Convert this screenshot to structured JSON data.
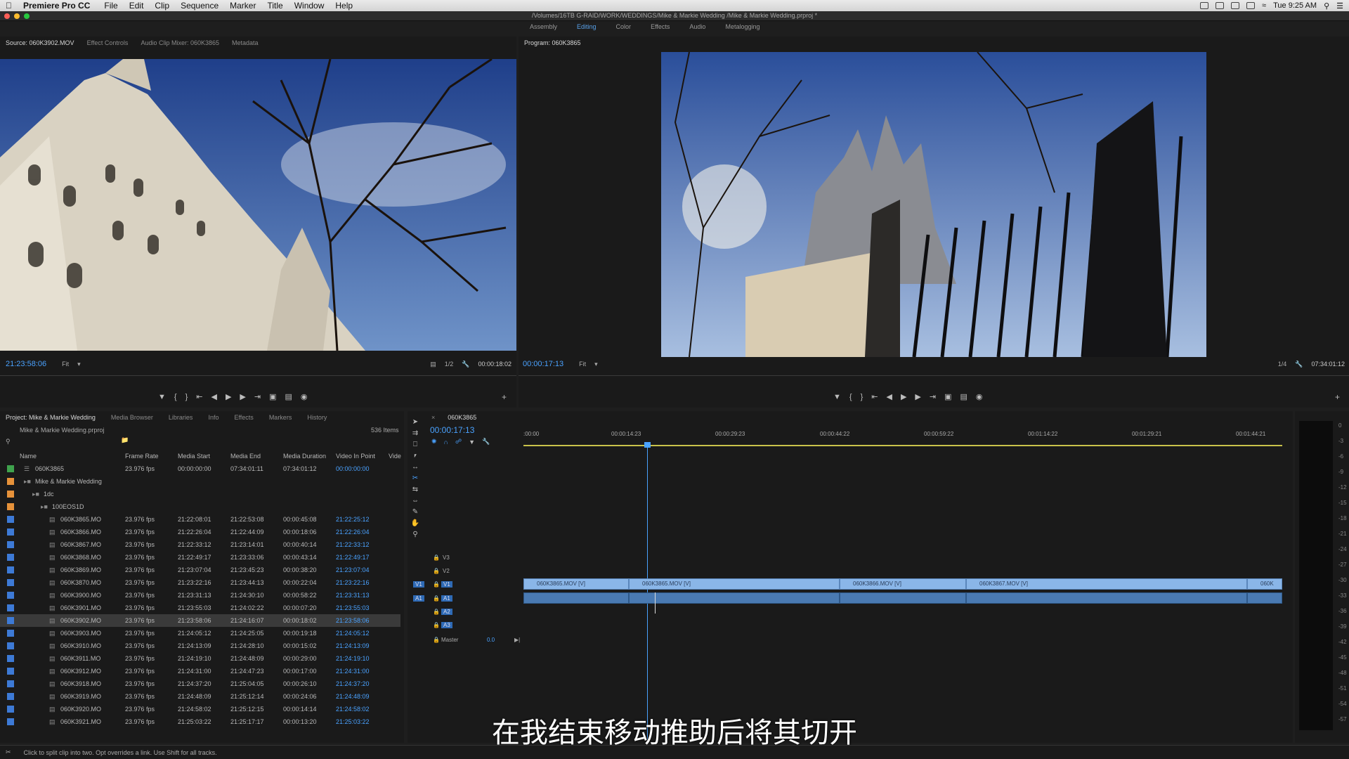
{
  "menubar": {
    "app": "Premiere Pro CC",
    "items": [
      "File",
      "Edit",
      "Clip",
      "Sequence",
      "Marker",
      "Title",
      "Window",
      "Help"
    ],
    "clock": "Tue 9:25 AM"
  },
  "title_path": "/Volumes/16TB G-RAID/WORK/WEDDINGS/Mike & Markie Wedding /Mike & Markie Wedding.prproj *",
  "workspaces": [
    "Assembly",
    "Editing",
    "Color",
    "Effects",
    "Audio",
    "Metalogging"
  ],
  "workspace_active": "Editing",
  "source": {
    "tabs": [
      "Source: 060K3902.MOV",
      "Effect Controls",
      "Audio Clip Mixer: 060K3865",
      "Metadata"
    ],
    "timecode": "21:23:58:06",
    "fit": "Fit",
    "resolution": "1/2",
    "duration": "00:00:18:02"
  },
  "program": {
    "tab": "Program: 060K3865",
    "timecode": "00:00:17:13",
    "fit": "Fit",
    "resolution": "1/4",
    "duration": "07:34:01:12"
  },
  "project": {
    "tabs": [
      "Project: Mike & Markie Wedding",
      "Media Browser",
      "Libraries",
      "Info",
      "Effects",
      "Markers",
      "History"
    ],
    "file": "Mike & Markie Wedding.prproj",
    "count": "536 Items",
    "columns": [
      "Name",
      "Frame Rate",
      "Media Start",
      "Media End",
      "Media Duration",
      "Video In Point",
      "Vide"
    ],
    "rows": [
      {
        "name": "060K3865",
        "fr": "23.976 fps",
        "ms": "00:00:00:00",
        "me": "07:34:01:11",
        "md": "07:34:01:12",
        "vi": "00:00:00:00",
        "color": "#3fa34d",
        "indent": 1
      },
      {
        "name": "Mike & Markie Wedding",
        "fr": "",
        "ms": "",
        "me": "",
        "md": "",
        "vi": "",
        "color": "#e6923a",
        "indent": 1
      },
      {
        "name": "1dc",
        "fr": "",
        "ms": "",
        "me": "",
        "md": "",
        "vi": "",
        "color": "#e6923a",
        "indent": 2
      },
      {
        "name": "100EOS1D",
        "fr": "",
        "ms": "",
        "me": "",
        "md": "",
        "vi": "",
        "color": "#e6923a",
        "indent": 3
      },
      {
        "name": "060K3865.MO",
        "fr": "23.976 fps",
        "ms": "21:22:08:01",
        "me": "21:22:53:08",
        "md": "00:00:45:08",
        "vi": "21:22:25:12",
        "color": "#3d7ad6",
        "indent": 4
      },
      {
        "name": "060K3866.MO",
        "fr": "23.976 fps",
        "ms": "21:22:26:04",
        "me": "21:22:44:09",
        "md": "00:00:18:06",
        "vi": "21:22:26:04",
        "color": "#3d7ad6",
        "indent": 4
      },
      {
        "name": "060K3867.MO",
        "fr": "23.976 fps",
        "ms": "21:22:33:12",
        "me": "21:23:14:01",
        "md": "00:00:40:14",
        "vi": "21:22:33:12",
        "color": "#3d7ad6",
        "indent": 4
      },
      {
        "name": "060K3868.MO",
        "fr": "23.976 fps",
        "ms": "21:22:49:17",
        "me": "21:23:33:06",
        "md": "00:00:43:14",
        "vi": "21:22:49:17",
        "color": "#3d7ad6",
        "indent": 4
      },
      {
        "name": "060K3869.MO",
        "fr": "23.976 fps",
        "ms": "21:23:07:04",
        "me": "21:23:45:23",
        "md": "00:00:38:20",
        "vi": "21:23:07:04",
        "color": "#3d7ad6",
        "indent": 4
      },
      {
        "name": "060K3870.MO",
        "fr": "23.976 fps",
        "ms": "21:23:22:16",
        "me": "21:23:44:13",
        "md": "00:00:22:04",
        "vi": "21:23:22:16",
        "color": "#3d7ad6",
        "indent": 4
      },
      {
        "name": "060K3900.MO",
        "fr": "23.976 fps",
        "ms": "21:23:31:13",
        "me": "21:24:30:10",
        "md": "00:00:58:22",
        "vi": "21:23:31:13",
        "color": "#3d7ad6",
        "indent": 4
      },
      {
        "name": "060K3901.MO",
        "fr": "23.976 fps",
        "ms": "21:23:55:03",
        "me": "21:24:02:22",
        "md": "00:00:07:20",
        "vi": "21:23:55:03",
        "color": "#3d7ad6",
        "indent": 4
      },
      {
        "name": "060K3902.MO",
        "fr": "23.976 fps",
        "ms": "21:23:58:06",
        "me": "21:24:16:07",
        "md": "00:00:18:02",
        "vi": "21:23:58:06",
        "color": "#3d7ad6",
        "indent": 4,
        "selected": true
      },
      {
        "name": "060K3903.MO",
        "fr": "23.976 fps",
        "ms": "21:24:05:12",
        "me": "21:24:25:05",
        "md": "00:00:19:18",
        "vi": "21:24:05:12",
        "color": "#3d7ad6",
        "indent": 4
      },
      {
        "name": "060K3910.MO",
        "fr": "23.976 fps",
        "ms": "21:24:13:09",
        "me": "21:24:28:10",
        "md": "00:00:15:02",
        "vi": "21:24:13:09",
        "color": "#3d7ad6",
        "indent": 4
      },
      {
        "name": "060K3911.MO",
        "fr": "23.976 fps",
        "ms": "21:24:19:10",
        "me": "21:24:48:09",
        "md": "00:00:29:00",
        "vi": "21:24:19:10",
        "color": "#3d7ad6",
        "indent": 4
      },
      {
        "name": "060K3912.MO",
        "fr": "23.976 fps",
        "ms": "21:24:31:00",
        "me": "21:24:47:23",
        "md": "00:00:17:00",
        "vi": "21:24:31:00",
        "color": "#3d7ad6",
        "indent": 4
      },
      {
        "name": "060K3918.MO",
        "fr": "23.976 fps",
        "ms": "21:24:37:20",
        "me": "21:25:04:05",
        "md": "00:00:26:10",
        "vi": "21:24:37:20",
        "color": "#3d7ad6",
        "indent": 4
      },
      {
        "name": "060K3919.MO",
        "fr": "23.976 fps",
        "ms": "21:24:48:09",
        "me": "21:25:12:14",
        "md": "00:00:24:06",
        "vi": "21:24:48:09",
        "color": "#3d7ad6",
        "indent": 4
      },
      {
        "name": "060K3920.MO",
        "fr": "23.976 fps",
        "ms": "21:24:58:02",
        "me": "21:25:12:15",
        "md": "00:00:14:14",
        "vi": "21:24:58:02",
        "color": "#3d7ad6",
        "indent": 4
      },
      {
        "name": "060K3921.MO",
        "fr": "23.976 fps",
        "ms": "21:25:03:22",
        "me": "21:25:17:17",
        "md": "00:00:13:20",
        "vi": "21:25:03:22",
        "color": "#3d7ad6",
        "indent": 4
      }
    ]
  },
  "timeline": {
    "tab": "060K3865",
    "timecode": "00:00:17:13",
    "ruler": [
      ":00:00",
      "00:00:14:23",
      "00:00:29:23",
      "00:00:44:22",
      "00:00:59:22",
      "00:01:14:22",
      "00:01:29:21",
      "00:01:44:21"
    ],
    "tracks": [
      "V3",
      "V2",
      "V1",
      "A1",
      "A2",
      "A3"
    ],
    "master": "Master",
    "master_val": "0.0",
    "clips": [
      "060K3865.MOV [V]",
      "060K3865.MOV [V]",
      "060K3866.MOV [V]",
      "060K3867.MOV [V]",
      "060K"
    ]
  },
  "meter": [
    "0",
    "-3",
    "-6",
    "-9",
    "-12",
    "-15",
    "-18",
    "-21",
    "-24",
    "-27",
    "-30",
    "-33",
    "-36",
    "-39",
    "-42",
    "-45",
    "-48",
    "-51",
    "-54",
    "-57"
  ],
  "status": "Click to split clip into two. Opt overrides a link. Use Shift for all tracks.",
  "subtitle": "在我结束移动推助后将其切开"
}
